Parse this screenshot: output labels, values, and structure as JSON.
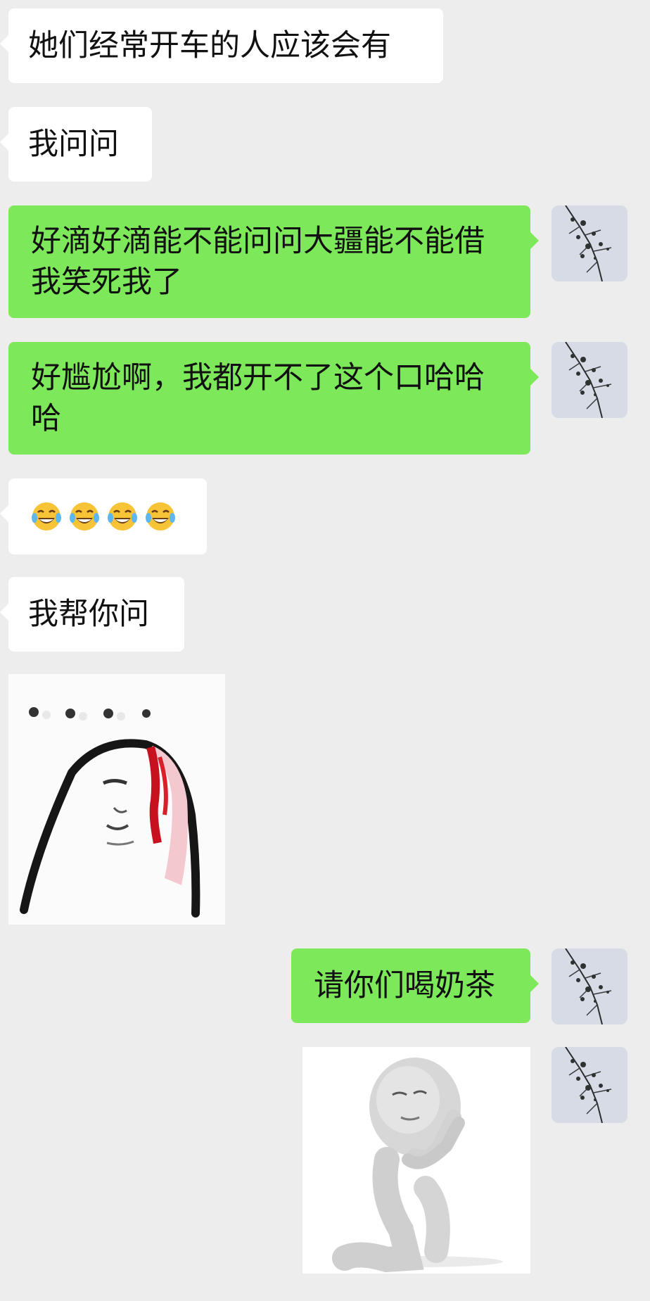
{
  "messages": [
    {
      "id": 1,
      "side": "in",
      "type": "text",
      "text": "她们经常开车的人应该会有"
    },
    {
      "id": 2,
      "side": "in",
      "type": "text",
      "text": "我问问"
    },
    {
      "id": 3,
      "side": "out",
      "type": "text",
      "text": "好滴好滴能不能问问大疆能不能借我笑死我了"
    },
    {
      "id": 4,
      "side": "out",
      "type": "text",
      "text": "好尴尬啊，我都开不了这个口哈哈哈"
    },
    {
      "id": 5,
      "side": "in",
      "type": "emoji",
      "emoji": "face-with-tears-of-joy",
      "count": 4
    },
    {
      "id": 6,
      "side": "in",
      "type": "text",
      "text": "我帮你问"
    },
    {
      "id": 7,
      "side": "in",
      "type": "sticker",
      "sticker": "bleeding-head-meme-sticker"
    },
    {
      "id": 8,
      "side": "out",
      "type": "text",
      "text": "请你们喝奶茶"
    },
    {
      "id": 9,
      "side": "out",
      "type": "sticker",
      "sticker": "kneeling-praying-figure-sticker"
    }
  ],
  "colors": {
    "background": "#ededed",
    "incoming_bubble": "#ffffff",
    "outgoing_bubble": "#7de85a"
  },
  "icons": {
    "avatar": "tree-branch-avatar-icon",
    "emoji": "face-with-tears-of-joy"
  }
}
